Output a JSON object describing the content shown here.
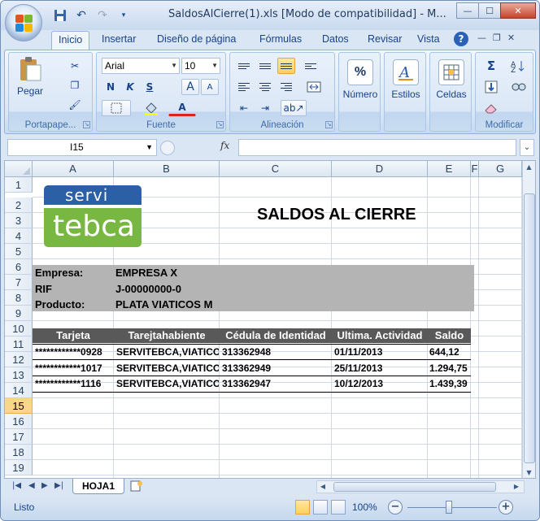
{
  "window": {
    "title": "SaldosAlCierre(1).xls  [Modo de compatibilidad] - M...",
    "controls": {
      "minimize": "—",
      "maximize": "☐",
      "close": "✕"
    }
  },
  "quick_access": [
    "save-icon",
    "undo-icon",
    "redo-icon",
    "customize-icon"
  ],
  "tabs": [
    "Inicio",
    "Insertar",
    "Diseño de página",
    "Fórmulas",
    "Datos",
    "Revisar",
    "Vista"
  ],
  "active_tab": "Inicio",
  "ribbon": {
    "portapapeles": {
      "label": "Portapape...",
      "paste": "Pegar"
    },
    "fuente": {
      "label": "Fuente",
      "font": "Arial",
      "size": "10",
      "bold": "N",
      "italic": "K",
      "underline": "S",
      "grow": "A",
      "shrink": "A",
      "font_color": "A"
    },
    "alineacion": {
      "label": "Alineación"
    },
    "numero": {
      "label": "Número",
      "icon": "%"
    },
    "estilos": {
      "label": "Estilos"
    },
    "celdas": {
      "label": "Celdas"
    },
    "modificar": {
      "label": "Modificar",
      "sum": "Σ"
    }
  },
  "formula_bar": {
    "name_box": "I15",
    "fx": "fx",
    "value": ""
  },
  "columns": [
    "A",
    "B",
    "C",
    "D",
    "E",
    "F",
    "G"
  ],
  "rows": [
    "1",
    "2",
    "3",
    "4",
    "5",
    "6",
    "7",
    "8",
    "9",
    "10",
    "11",
    "12",
    "13",
    "14",
    "15",
    "16",
    "17",
    "18",
    "19"
  ],
  "selected_row": "15",
  "sheet": {
    "logo": {
      "top": "servi",
      "bottom": "tebca"
    },
    "title": "SALDOS AL CIERRE",
    "info": [
      {
        "label": "Empresa:",
        "value": "EMPRESA X"
      },
      {
        "label": "RIF",
        "value": "J-00000000-0"
      },
      {
        "label": "Producto:",
        "value": "PLATA VIATICOS M"
      }
    ],
    "table_headers": [
      "Tarjeta",
      "Tarejtahabiente",
      "Cédula de Identidad",
      "Ultima. Actividad",
      "Saldo"
    ],
    "table_rows": [
      [
        "************0928",
        "SERVITEBCA,VIATICOS",
        "313362948",
        "01/11/2013",
        "644,12"
      ],
      [
        "************1017",
        "SERVITEBCA,VIATICOS",
        "313362949",
        "25/11/2013",
        "1.294,75"
      ],
      [
        "************1116",
        "SERVITEBCA,VIATICOS",
        "313362947",
        "10/12/2013",
        "1.439,39"
      ]
    ]
  },
  "sheet_tabs": [
    "HOJA1"
  ],
  "status": {
    "text": "Listo",
    "zoom": "100%"
  },
  "colors": {
    "accent": "#15428b",
    "logo_blue": "#2b5fa6",
    "logo_green": "#79b743",
    "info_fill": "#b4b4b4",
    "header_fill": "#595959"
  }
}
